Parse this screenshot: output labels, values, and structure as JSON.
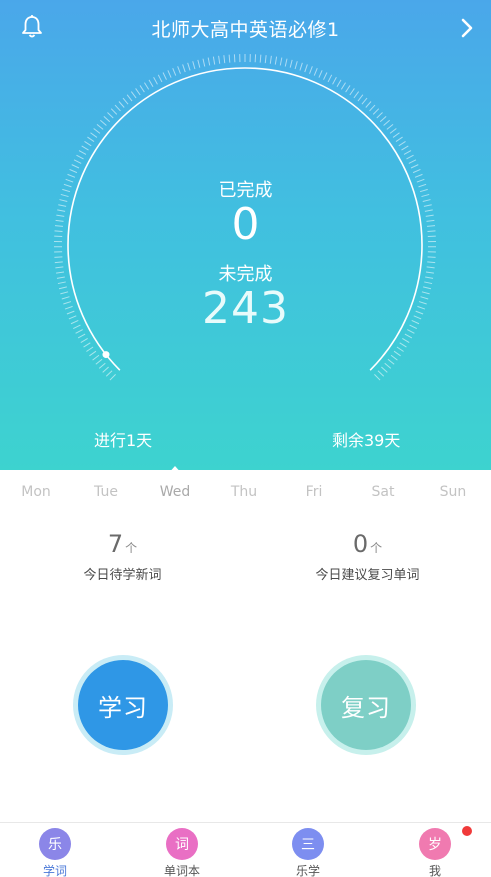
{
  "header": {
    "title": "北师大高中英语必修1",
    "bell_icon": "bell-icon",
    "next_icon": "chevron-right-icon"
  },
  "progress": {
    "completed_label": "已完成",
    "completed_value": "0",
    "remaining_label": "未完成",
    "remaining_value": "243",
    "days_elapsed": "进行1天",
    "days_left": "剩余39天",
    "elapsed_fraction": 0.025
  },
  "week": {
    "days": [
      "Mon",
      "Tue",
      "Wed",
      "Thu",
      "Fri",
      "Sat",
      "Sun"
    ],
    "active_index": 2
  },
  "stats": {
    "new_words_count": "7",
    "new_words_unit": "个",
    "new_words_label": "今日待学新词",
    "review_count": "0",
    "review_unit": "个",
    "review_label": "今日建议复习单词"
  },
  "actions": {
    "learn_label": "学习",
    "review_label": "复习"
  },
  "tabs": [
    {
      "glyph": "乐",
      "label": "学词",
      "color": "#8b86e8",
      "active": true
    },
    {
      "glyph": "词",
      "label": "单词本",
      "color": "#e96fc4",
      "active": false
    },
    {
      "glyph": "三",
      "label": "乐学",
      "color": "#7d8ef0",
      "active": false
    },
    {
      "glyph": "岁",
      "label": "我",
      "color": "#f07ab0",
      "active": false
    }
  ],
  "colors": {
    "gradient_top": "#4aa7ea",
    "gradient_bottom": "#3dd3cf",
    "learn_button": "#2f97e6",
    "review_button": "#7ecfc6",
    "active_tab": "#4a78d8",
    "badge": "#f03a3a"
  }
}
